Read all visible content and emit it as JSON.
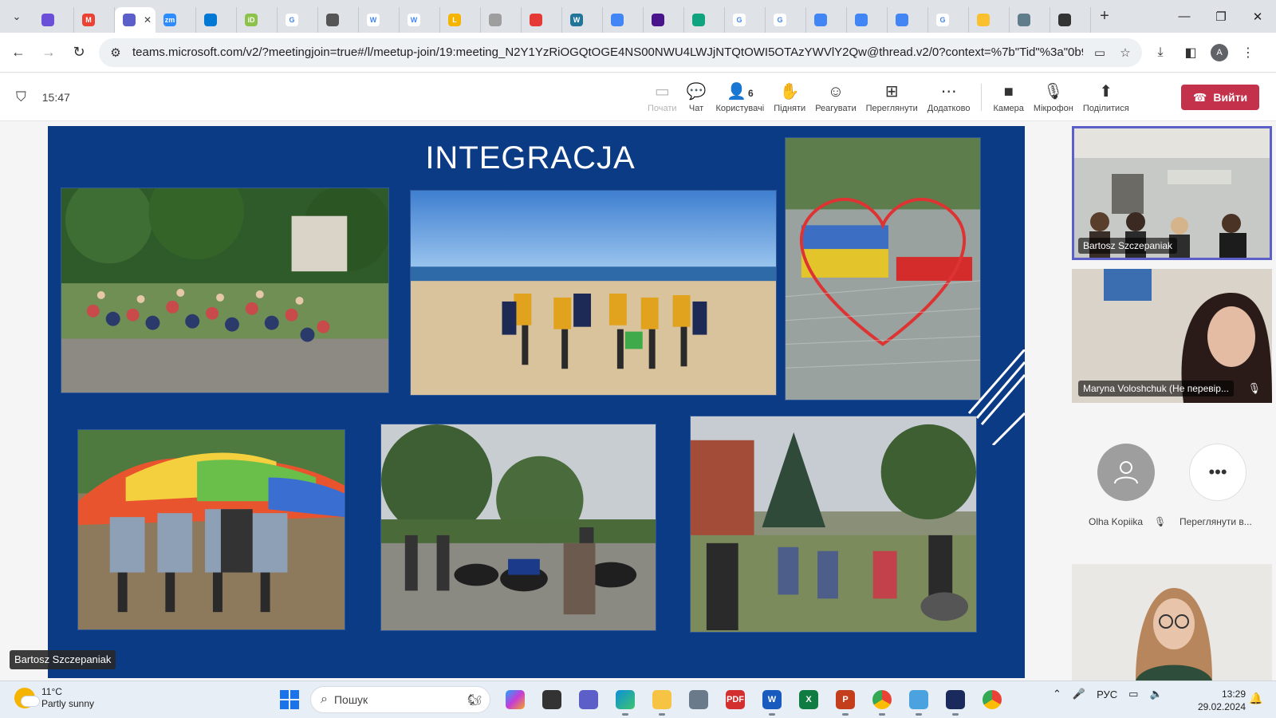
{
  "browser": {
    "tabs": [
      {
        "label": "",
        "icon": "copilot-icon",
        "color": "#6b4fd8"
      },
      {
        "label": "M",
        "icon": "gmail-icon",
        "color": "#ea4335"
      },
      {
        "label": "",
        "icon": "teams-icon",
        "color": "#5b5fc7",
        "active": true
      },
      {
        "label": "zm",
        "icon": "zoom-icon",
        "color": "#2d8cff"
      },
      {
        "label": "",
        "icon": "azure-icon",
        "color": "#0078d4"
      },
      {
        "label": "iD",
        "icon": "id-icon",
        "color": "#8bc34a"
      },
      {
        "label": "G",
        "icon": "google-icon",
        "color": "#ffffff"
      },
      {
        "label": "",
        "icon": "globe-icon",
        "color": "#555555"
      },
      {
        "label": "W",
        "icon": "wiki-icon",
        "color": "#ffffff"
      },
      {
        "label": "W",
        "icon": "wiki-icon",
        "color": "#ffffff"
      },
      {
        "label": "L",
        "icon": "l-icon",
        "color": "#f4b400"
      },
      {
        "label": "",
        "icon": "puzzle-icon",
        "color": "#9e9e9e"
      },
      {
        "label": "",
        "icon": "pin-icon",
        "color": "#e53935"
      },
      {
        "label": "W",
        "icon": "wordpress-icon",
        "color": "#21759b"
      },
      {
        "label": "",
        "icon": "docs-icon",
        "color": "#4285f4"
      },
      {
        "label": "",
        "icon": "app-icon",
        "color": "#4a148c"
      },
      {
        "label": "",
        "icon": "chatgpt-icon",
        "color": "#10a37f"
      },
      {
        "label": "G",
        "icon": "google-icon",
        "color": "#ffffff"
      },
      {
        "label": "G",
        "icon": "google-icon",
        "color": "#ffffff"
      },
      {
        "label": "",
        "icon": "lens-icon",
        "color": "#4285f4"
      },
      {
        "label": "",
        "icon": "lens-icon",
        "color": "#4285f4"
      },
      {
        "label": "",
        "icon": "lens-icon",
        "color": "#4285f4"
      },
      {
        "label": "G",
        "icon": "google-icon",
        "color": "#ffffff"
      },
      {
        "label": "",
        "icon": "emoji-icon",
        "color": "#fbc02d"
      },
      {
        "label": "",
        "icon": "hat-icon",
        "color": "#607d8b"
      },
      {
        "label": "",
        "icon": "clock-icon",
        "color": "#333333"
      }
    ],
    "url": "teams.microsoft.com/v2/?meetingjoin=true#/l/meetup-join/19:meeting_N2Y1YzRiOGQtOGE4NS00NWU4LWJjNTQtOWI5OTAzYWVlY2Qw@thread.v2/0?context=%7b\"Tid\"%3a\"0b94c4fb...",
    "profile_initial": "A"
  },
  "teams": {
    "meeting_time": "15:47",
    "toolbar": [
      {
        "label": "Почати",
        "icon": "share-screen-icon",
        "disabled": true
      },
      {
        "label": "Чат",
        "icon": "chat-icon"
      },
      {
        "label": "Користувачі",
        "icon": "people-icon",
        "badge": "6"
      },
      {
        "label": "Підняти",
        "icon": "raise-hand-icon"
      },
      {
        "label": "Реагувати",
        "icon": "react-icon"
      },
      {
        "label": "Переглянути",
        "icon": "view-icon"
      },
      {
        "label": "Додатково",
        "icon": "more-icon"
      }
    ],
    "media": [
      {
        "label": "Камера",
        "icon": "camera-icon"
      },
      {
        "label": "Мікрофон",
        "icon": "mic-off-icon"
      },
      {
        "label": "Поділитися",
        "icon": "share-icon"
      }
    ],
    "leave_label": "Вийти"
  },
  "slide": {
    "title": "INTEGRACJA",
    "speaker": "Bartosz Szczepaniak"
  },
  "participants": {
    "tile1_name": "Bartosz Szczepaniak",
    "tile2_name": "Maryna Voloshchuk (Не перевір...",
    "avatar1_name": "Olha Kopiika",
    "avatar2_name": "Переглянути в..."
  },
  "taskbar": {
    "temperature": "11°C",
    "weather": "Partly sunny",
    "search_placeholder": "Пошук",
    "language": "РУС",
    "time": "13:29",
    "date": "29.02.2024"
  }
}
